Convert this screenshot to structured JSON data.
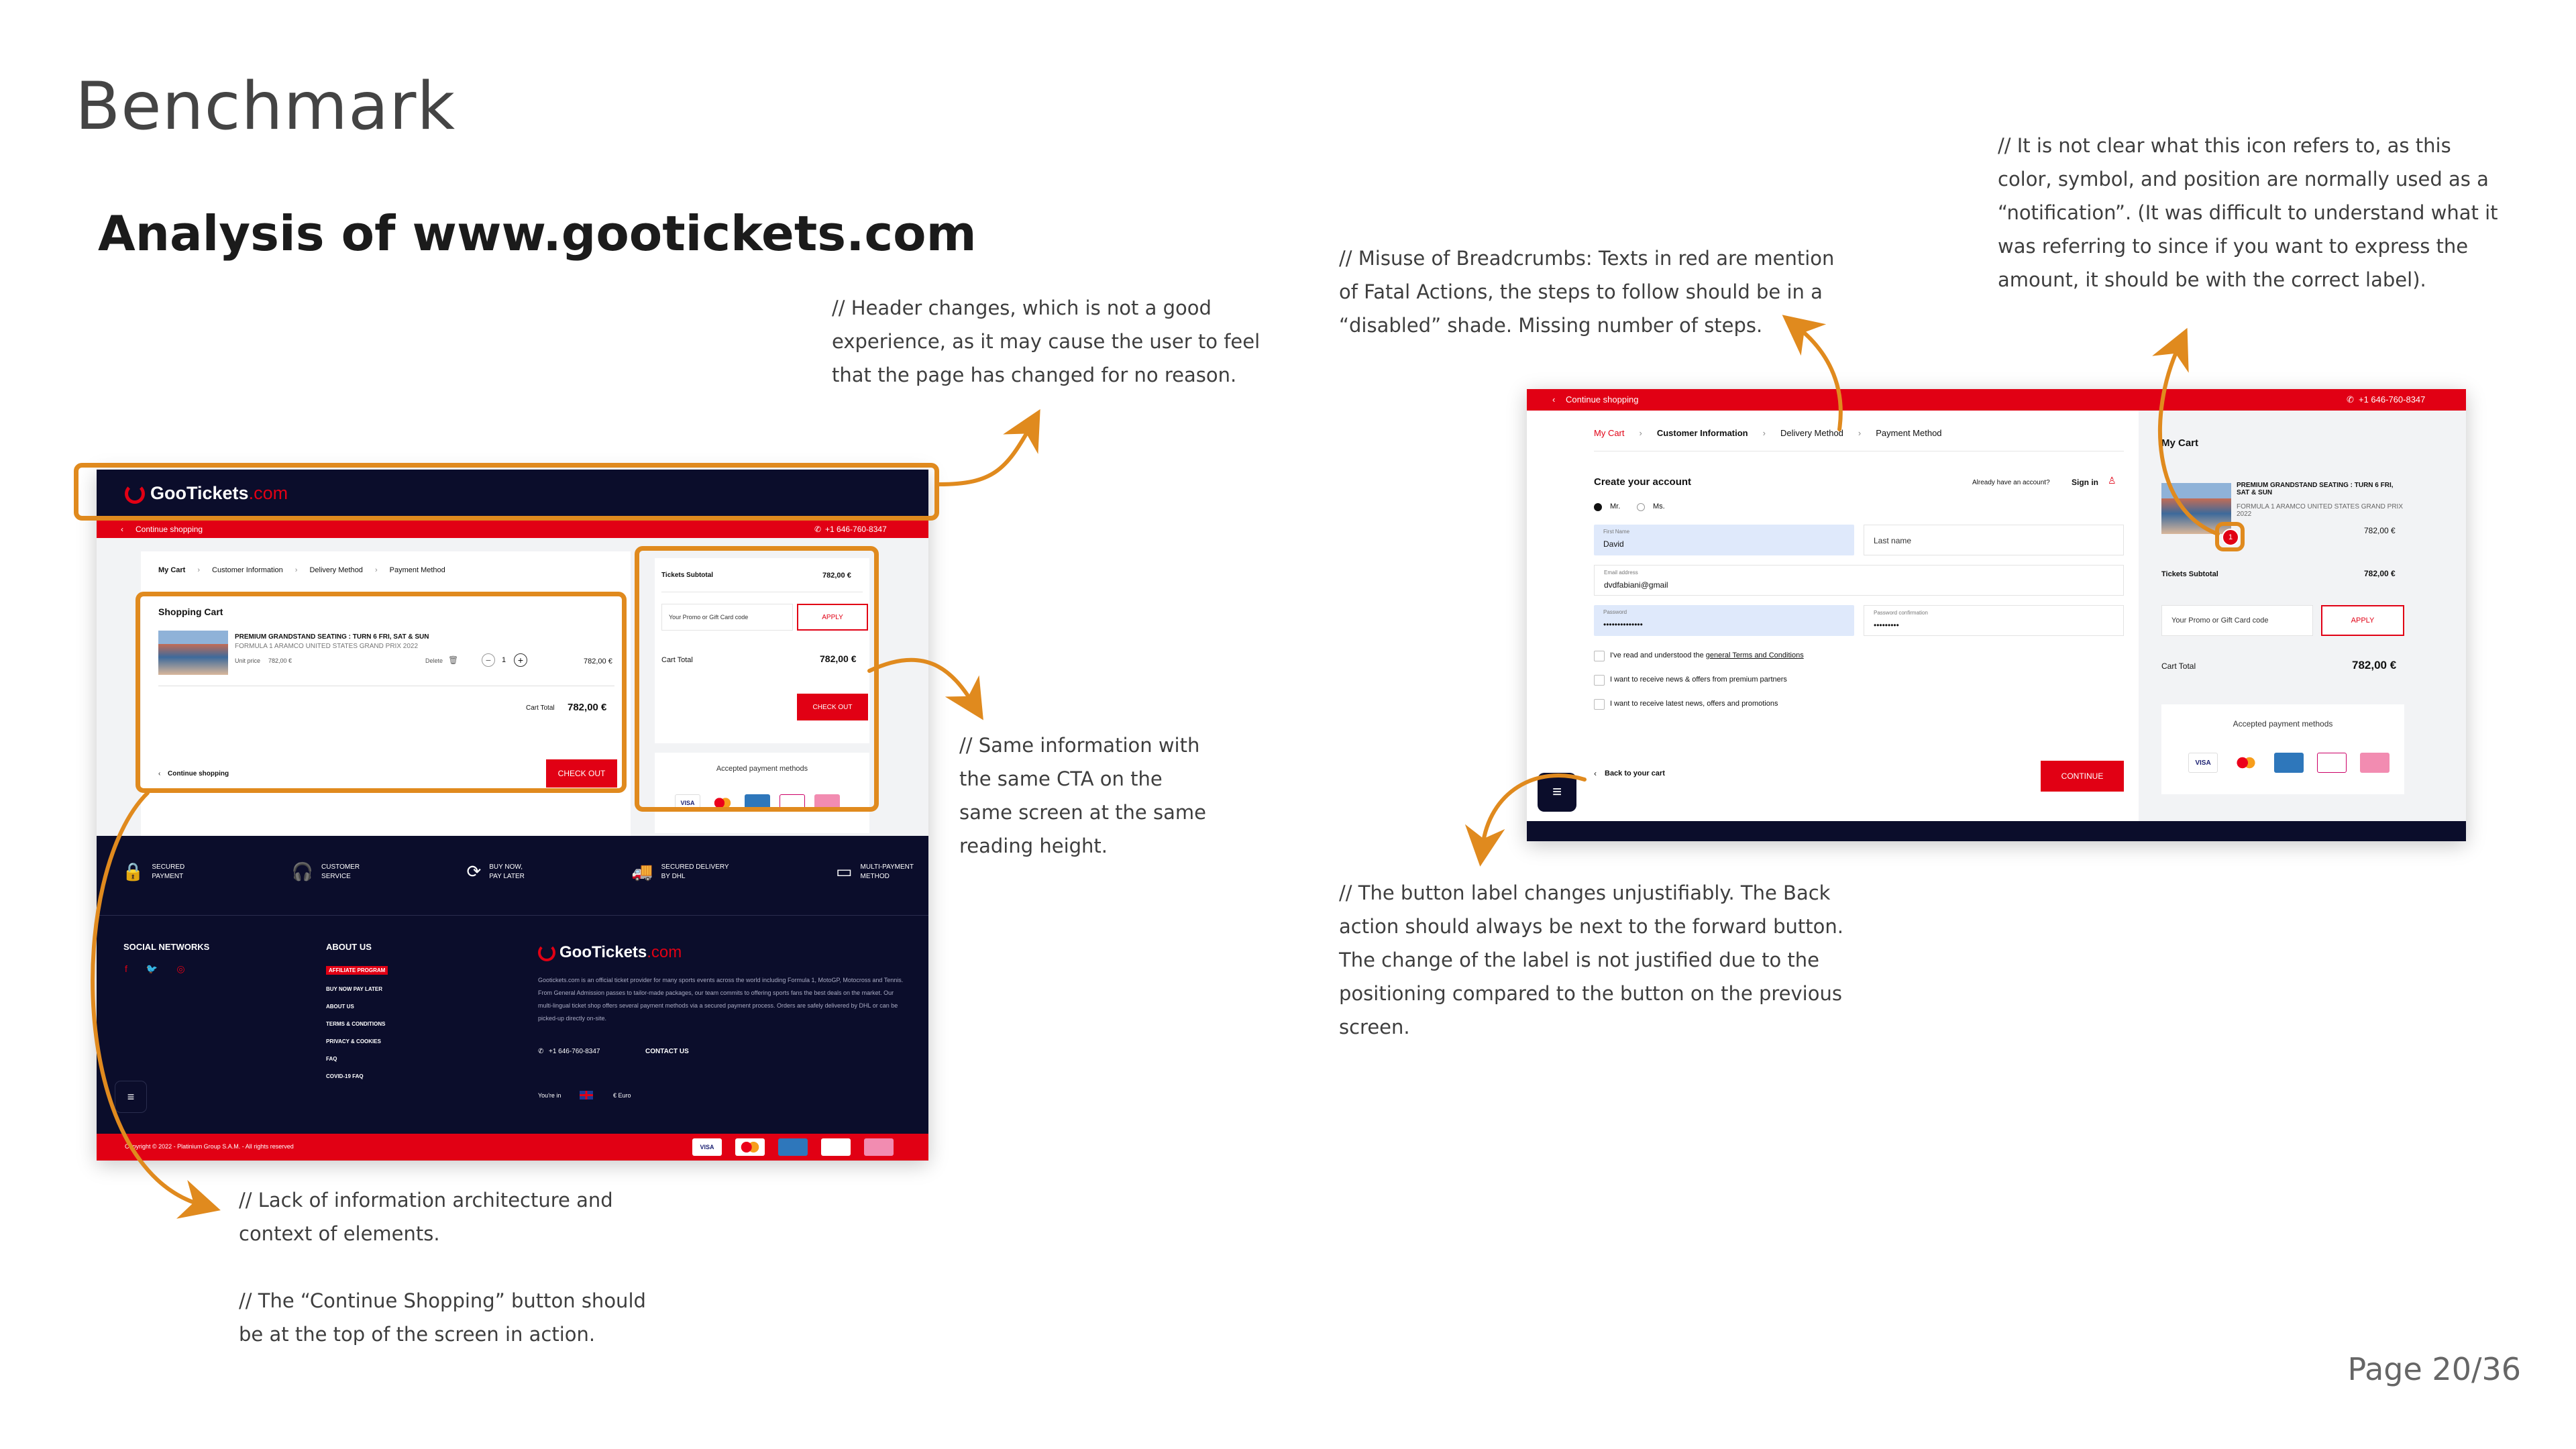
{
  "slide": {
    "title": "Benchmark",
    "subtitle": "Analysis of www.gootickets.com",
    "page": "Page 20/36"
  },
  "notes": {
    "header": "// Header changes, which is not a good experience, as it may cause the user to feel that the page has changed for no reason.",
    "same_info": "// Same information with the same CTA on the same screen at the same reading height.",
    "breadcrumbs": "// Misuse of Breadcrumbs: Texts in red are mention of Fatal Actions, the steps to follow should be in a “disabled” shade. Missing number of steps.",
    "icon": "// It is not clear what this icon refers to, as this color, symbol, and position are normally used as a “notification”. (It was difficult to understand what it was referring to since if you want to express the amount, it should be with the correct label).",
    "button_label": "// The button label changes unjustifiably. The Back action should always be next to the forward button. The change of the label is not justified due to the positioning compared to the button on the previous screen.",
    "lack_ia": "// Lack of information architecture and context of elements.",
    "continue_shopping": "// The “Continue Shopping” button should be at the top of the screen in action."
  },
  "colors": {
    "accent": "#e08a1e",
    "brand_red": "#e10014",
    "navy": "#0b0d2b"
  },
  "cart_screen": {
    "logo": "GooTickets",
    "logo_suffix": ".com",
    "continue_shopping_top": "Continue shopping",
    "phone": "+1 646-760-8347",
    "breadcrumbs": [
      "My Cart",
      "Customer Information",
      "Delivery Method",
      "Payment Method"
    ],
    "cart_title": "Shopping Cart",
    "item_title": "PREMIUM GRANDSTAND SEATING : TURN 6 FRI, SAT & SUN",
    "item_subtitle": "FORMULA 1 ARAMCO UNITED STATES GRAND PRIX 2022",
    "unit_price_label": "Unit price",
    "unit_price": "782,00 €",
    "delete_label": "Delete",
    "qty": "1",
    "item_total": "782,00 €",
    "cart_total_label": "Cart Total",
    "cart_total": "782,00 €",
    "continue_shopping": "Continue shopping",
    "checkout_btn": "CHECK OUT",
    "subtotal_label": "Tickets Subtotal",
    "subtotal": "782,00 €",
    "promo_placeholder": "Your Promo or Gift Card code",
    "apply": "APPLY",
    "cart_total_label2": "Cart Total",
    "cart_total2": "782,00 €",
    "checkout_btn2": "CHECK OUT",
    "payment_methods": "Accepted payment methods",
    "features": [
      {
        "line1": "SECURED",
        "line2": "PAYMENT",
        "icon": "lock-icon"
      },
      {
        "line1": "CUSTOMER",
        "line2": "SERVICE",
        "icon": "headset-icon"
      },
      {
        "line1": "BUY NOW,",
        "line2": "PAY LATER",
        "icon": "installments-icon"
      },
      {
        "line1": "SECURED DELIVERY",
        "line2": "BY DHL",
        "icon": "truck-icon"
      },
      {
        "line1": "MULTI-PAYMENT",
        "line2": "METHOD",
        "icon": "card-icon"
      }
    ],
    "social_title": "SOCIAL NETWORKS",
    "about_title": "ABOUT US",
    "about_links": [
      "AFFILIATE PROGRAM",
      "BUY NOW PAY LATER",
      "ABOUT US",
      "TERMS & CONDITIONS",
      "PRIVACY & COOKIES",
      "FAQ",
      "COVID-19 FAQ"
    ],
    "footer_text": "Gootickets.com is an official ticket provider for many sports events across the world including Formula 1, MotoGP, Motocross and Tennis. From General Admission passes to tailor-made packages, our team commits to offering sports fans the best deals on the market. Our multi-lingual ticket shop offers several payment methods via a secured payment process. Orders are safely delivered by DHL or can be picked-up directly on-site.",
    "footer_phone": "+1 646-760-8347",
    "contact": "CONTACT US",
    "youre_in": "You're in",
    "currency": "€ Euro",
    "copyright": "Copyright © 2022 - Platinium Group S.A.M. - All rights reserved"
  },
  "info_screen": {
    "continue_shopping_top": "Continue shopping",
    "phone": "+1 646-760-8347",
    "breadcrumbs": [
      "My Cart",
      "Customer Information",
      "Delivery Method",
      "Payment Method"
    ],
    "create_account": "Create your account",
    "already": "Already have an account?",
    "sign_in": "Sign in",
    "mr": "Mr.",
    "ms": "Ms.",
    "first_name_label": "First Name",
    "first_name": "David",
    "last_name_placeholder": "Last name",
    "email_label": "Email address",
    "email": "dvdfabiani@gmail",
    "password_label": "Password",
    "password": "••••••••••••••",
    "password_conf_label": "Password confirmation",
    "password_conf": "•••••••••",
    "terms_prefix": "I've read and understood the",
    "terms_link": "general Terms and Conditions",
    "partners": "I want to receive news & offers from premium partners",
    "latest": "I want to receive latest news, offers and promotions",
    "back_to_cart": "Back to your cart",
    "continue_btn": "CONTINUE",
    "my_cart": "My Cart",
    "item_title": "PREMIUM GRANDSTAND SEATING : TURN 6 FRI, SAT & SUN",
    "item_subtitle": "FORMULA 1 ARAMCO UNITED STATES GRAND PRIX 2022",
    "item_price": "782,00 €",
    "badge": "1",
    "subtotal_label": "Tickets Subtotal",
    "subtotal": "782,00 €",
    "promo_placeholder": "Your Promo or Gift Card code",
    "apply": "APPLY",
    "cart_total_label": "Cart Total",
    "cart_total": "782,00 €",
    "payment_methods": "Accepted payment methods"
  }
}
